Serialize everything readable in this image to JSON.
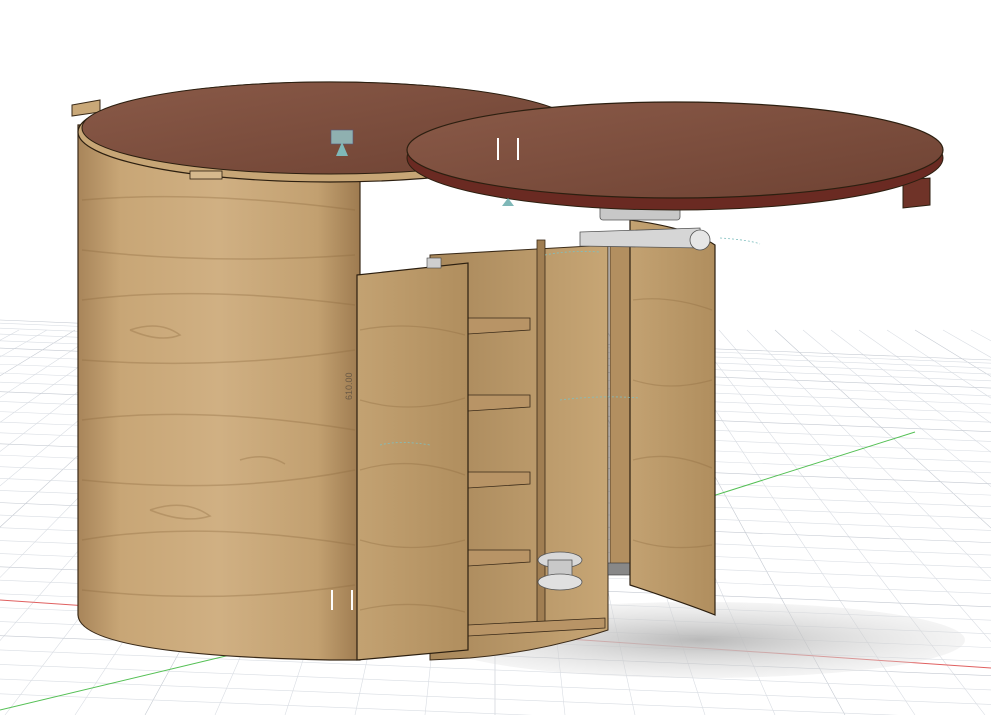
{
  "viewport": {
    "background": "#ffffff",
    "grid_color": "#d9dde3",
    "grid_major_color": "#c4c9d1",
    "x_axis_color": "#e06060",
    "y_axis_color": "#55c055"
  },
  "model": {
    "wood_light": "#c9a878",
    "wood_mid": "#b38f5e",
    "wood_dark": "#8f6c40",
    "top_color": "#7a4a3a",
    "top_edge_color": "#6a2a22",
    "shadow_color": "#cfcfcf"
  },
  "dimension_text": "610.00"
}
